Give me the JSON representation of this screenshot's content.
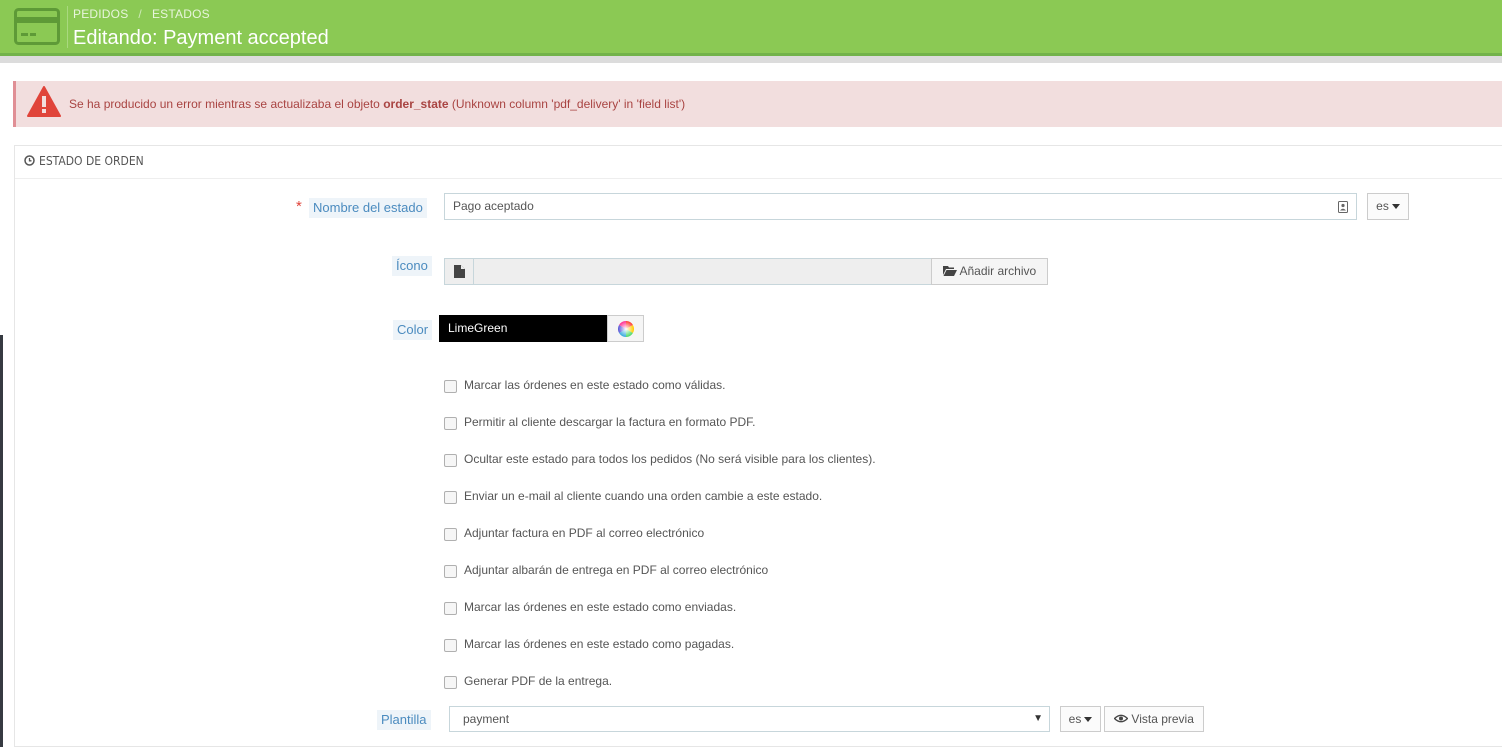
{
  "header": {
    "breadcrumb": [
      "PEDIDOS",
      "ESTADOS"
    ],
    "breadcrumb_separator": "/",
    "title": "Editando: Payment accepted",
    "icon": "credit-card-icon",
    "bg_color": "#8bc954"
  },
  "alert": {
    "text_before": "Se ha producido un error mientras se actualizaba el objeto ",
    "text_bold": "order_state",
    "text_after": " (Unknown column 'pdf_delivery' in 'field list')",
    "icon": "warning-triangle-icon",
    "bg_color": "#f2dede"
  },
  "panel": {
    "title": "ESTADO DE ORDEN",
    "icon": "clock-icon"
  },
  "form": {
    "name_label": "Nombre del estado",
    "required_mark": "*",
    "name_value": "Pago aceptado",
    "name_lang": "es",
    "icon_label": "Ícono",
    "add_file_label": "Añadir archivo",
    "color_label": "Color",
    "color_value": "LimeGreen",
    "checkboxes": [
      {
        "label": "Marcar las órdenes en este estado como válidas.",
        "checked": false
      },
      {
        "label": "Permitir al cliente descargar la factura en formato PDF.",
        "checked": false
      },
      {
        "label": "Ocultar este estado para todos los pedidos (No será visible para los clientes).",
        "checked": false
      },
      {
        "label": "Enviar un e-mail al cliente cuando una orden cambie a este estado.",
        "checked": false
      },
      {
        "label": "Adjuntar factura en PDF al correo electrónico",
        "checked": false
      },
      {
        "label": "Adjuntar albarán de entrega en PDF al correo electrónico",
        "checked": false
      },
      {
        "label": "Marcar las órdenes en este estado como enviadas.",
        "checked": false
      },
      {
        "label": "Marcar las órdenes en este estado como pagadas.",
        "checked": false
      },
      {
        "label": "Generar PDF de la entrega.",
        "checked": false
      }
    ],
    "template_label": "Plantilla",
    "template_value": "payment",
    "template_lang": "es",
    "preview_label": "Vista previa"
  }
}
